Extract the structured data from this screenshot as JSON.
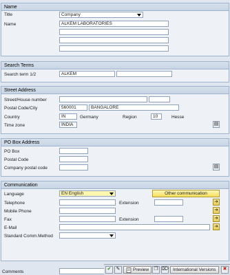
{
  "name_section": {
    "header": "Name",
    "title_label": "Title",
    "title_value": "Company",
    "name_label": "Name",
    "name_value": "ALKEM LABORATORIES"
  },
  "search_section": {
    "header": "Search Terms",
    "term_label": "Search term 1/2",
    "term1_value": "ALKEM",
    "term2_value": ""
  },
  "street_section": {
    "header": "Street Address",
    "street_label": "Street/House number",
    "postal_label": "Postal Code/City",
    "postal_value": "560001",
    "city_value": "BANGALORE",
    "country_label": "Country",
    "country_value": "IN",
    "country_name": "Germany",
    "region_label": "Region",
    "region_value": "10",
    "region_name": "Hesse",
    "timezone_label": "Time zone",
    "timezone_value": "INDIA"
  },
  "pobox_section": {
    "header": "PO Box Address",
    "pobox_label": "PO Box",
    "postal_label": "Postal Code",
    "company_postal_label": "Company postal code"
  },
  "comm_section": {
    "header": "Communication",
    "language_label": "Language",
    "language_value": "EN English",
    "other_comm_label": "Other communication",
    "telephone_label": "Telephone",
    "extension_label": "Extension",
    "mobile_label": "Mobile Phone",
    "fax_label": "Fax",
    "fax_extension_label": "Extension",
    "email_label": "E-Mail",
    "std_comm_label": "Standard Comm.Method"
  },
  "comments_label": "Comments",
  "toolbar": {
    "preview_label": "Preview",
    "intl_label": "International Versions"
  },
  "colors": {
    "header_bg": "#c8d5e5",
    "group_border": "#9fb3cc",
    "accent_yellow": "#f5de5c",
    "ok_green": "#2f8a1e",
    "cancel_red": "#c0271a"
  }
}
